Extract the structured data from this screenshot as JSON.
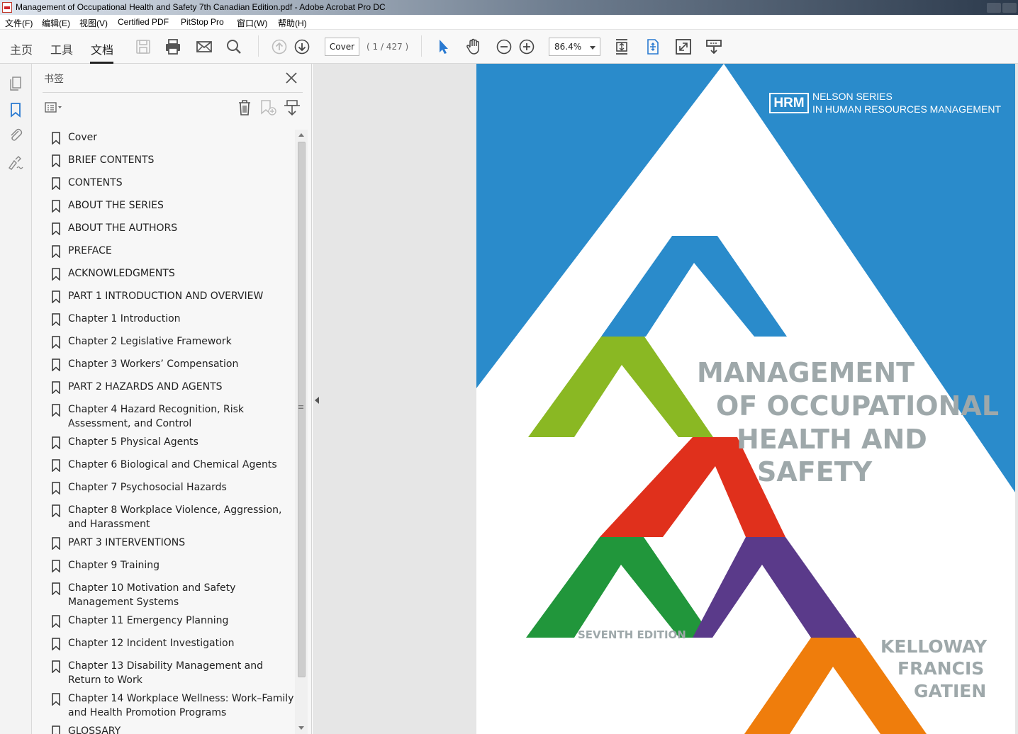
{
  "window": {
    "title": "Management of Occupational Health and Safety 7th Canadian Edition.pdf - Adobe Acrobat Pro DC"
  },
  "menu": [
    "文件(F)",
    "编辑(E)",
    "视图(V)",
    "Certified PDF",
    "PitStop Pro",
    "窗口(W)",
    "帮助(H)"
  ],
  "tabs": [
    {
      "label": "主页",
      "active": false
    },
    {
      "label": "工具",
      "active": false
    },
    {
      "label": "文档",
      "active": true
    }
  ],
  "toolbar": {
    "page_label": "Cover",
    "page_count": "( 1 / 427 )",
    "zoom": "86.4%"
  },
  "panel": {
    "title": "书签",
    "bookmarks": [
      {
        "label": "Cover"
      },
      {
        "label": "BRIEF CONTENTS"
      },
      {
        "label": "CONTENTS"
      },
      {
        "label": "ABOUT THE SERIES"
      },
      {
        "label": "ABOUT THE AUTHORS"
      },
      {
        "label": "PREFACE"
      },
      {
        "label": "ACKNOWLEDGMENTS"
      },
      {
        "label": "PART 1 INTRODUCTION AND OVERVIEW"
      },
      {
        "label": "Chapter 1 Introduction"
      },
      {
        "label": "Chapter 2 Legislative Framework"
      },
      {
        "label": "Chapter 3 Workers’ Compensation"
      },
      {
        "label": "PART 2 HAZARDS AND AGENTS"
      },
      {
        "label": "Chapter 4 Hazard Recognition, Risk Assessment, and Control"
      },
      {
        "label": "Chapter 5 Physical Agents"
      },
      {
        "label": "Chapter 6 Biological and Chemical Agents"
      },
      {
        "label": "Chapter 7 Psychosocial Hazards"
      },
      {
        "label": "Chapter 8 Workplace Violence, Aggression, and Harassment"
      },
      {
        "label": "PART 3 INTERVENTIONS"
      },
      {
        "label": "Chapter 9 Training"
      },
      {
        "label": "Chapter 10 Motivation and Safety Management Systems"
      },
      {
        "label": "Chapter 11 Emergency Planning"
      },
      {
        "label": "Chapter 12 Incident Investigation"
      },
      {
        "label": "Chapter 13 Disability Management and Return to Work"
      },
      {
        "label": "Chapter 14 Workplace Wellness: Work–Family and Health Promotion Programs"
      },
      {
        "label": "GLOSSARY"
      }
    ]
  },
  "cover": {
    "badge": "HRM",
    "series_line1": "NELSON SERIES",
    "series_line2": "IN HUMAN RESOURCES MANAGEMENT",
    "title_lines": [
      "MANAGEMENT",
      "OF OCCUPATIONAL",
      "HEALTH AND",
      "SAFETY"
    ],
    "edition": "SEVENTH EDITION",
    "authors": [
      "KELLOWAY",
      "FRANCIS",
      "GATIEN"
    ],
    "colors": {
      "sky": "#2a8bcb",
      "blue_chevron": "#2a8bcb",
      "lime_chevron": "#8ab823",
      "red_chevron": "#e0301c",
      "green_chevron": "#21963b",
      "purple_chevron": "#5a3a8a",
      "orange_chevron": "#ef7d0c",
      "title_gray": "#9ea8aa"
    }
  }
}
